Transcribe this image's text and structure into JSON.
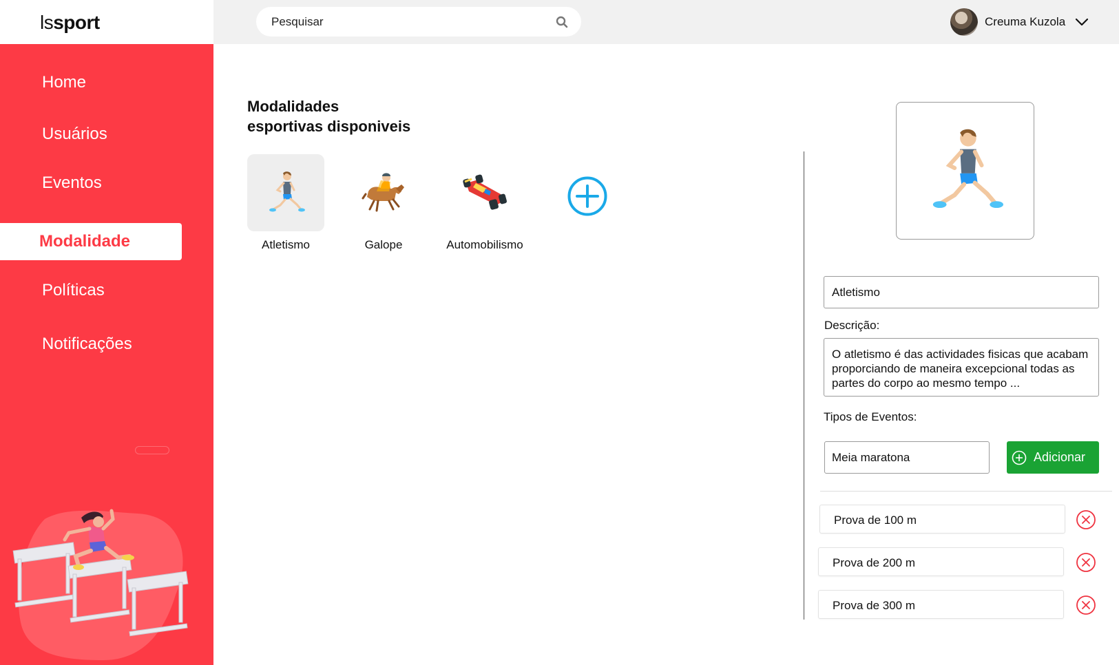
{
  "app": {
    "logo_prefix": "ls",
    "logo_suffix": "sport"
  },
  "search": {
    "placeholder": "Pesquisar"
  },
  "user": {
    "name": "Creuma Kuzola"
  },
  "sidebar": {
    "items": [
      {
        "label": "Home"
      },
      {
        "label": "Usuários"
      },
      {
        "label": "Eventos"
      },
      {
        "label": "Modalidade",
        "active": true
      },
      {
        "label": "Políticas"
      },
      {
        "label": "Notificações"
      }
    ]
  },
  "main": {
    "title_line1": "Modalidades",
    "title_line2": "esportivas disponiveis",
    "sports": [
      {
        "label": "Atletismo",
        "icon": "runner-icon",
        "selected": true
      },
      {
        "label": "Galope",
        "icon": "horse-racing-icon"
      },
      {
        "label": "Automobilismo",
        "icon": "race-car-icon"
      }
    ]
  },
  "detail": {
    "name_value": "Atletismo",
    "description_label": "Descrição:",
    "description_value": "O atletismo é das actividades fisicas que acabam proporciando de maneira excepcional todas as partes do corpo ao mesmo tempo ...",
    "event_types_label": "Tipos de Eventos:",
    "event_input_value": "Meia maratona",
    "add_button_label": "Adicionar",
    "events": [
      {
        "label": "Prova de 100 m"
      },
      {
        "label": "Prova de 200 m"
      },
      {
        "label": "Prova de 300 m"
      }
    ]
  },
  "colors": {
    "brand_red": "#fd3a45",
    "add_green": "#1aa334",
    "add_blue": "#1aa9e8",
    "remove_red": "#ef3340"
  }
}
